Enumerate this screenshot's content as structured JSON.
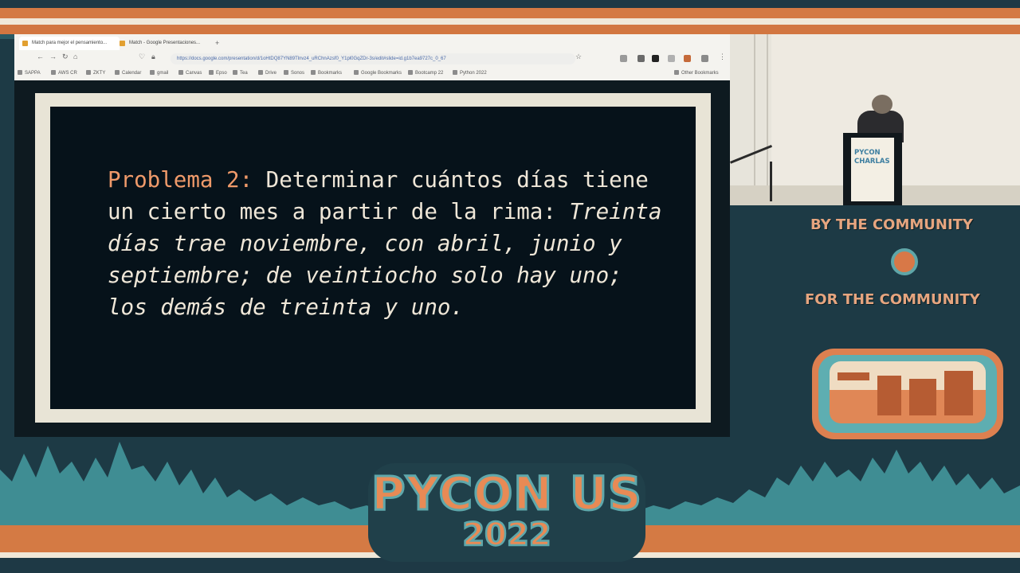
{
  "browser": {
    "tabs": [
      {
        "label": "Match para mejor el pensamiento..."
      },
      {
        "label": "Match - Google Presentaciones..."
      }
    ],
    "new_tab_icon": "plus-icon",
    "url": "https://docs.google.com/presentation/d/1oHtDQ87YN89Tlnvz4_uRChnAzsf0_Y1pl0GqZDr-3s/edit#slide=id.g1b7ea9727c_0_67",
    "bookmarks": [
      "SAPPA",
      "AWS CR",
      "ZKTY",
      "Calendar",
      "gmail",
      "Canvas",
      "Epso",
      "Tea",
      "Drive",
      "Sonos",
      "Bookmarks",
      "Google Bookmarks",
      "Bootcamp 22",
      "Python 2022"
    ],
    "other_bookmarks": "Other Bookmarks"
  },
  "slide": {
    "label": "Problema 2:",
    "statement": " Determinar cuántos días tiene un cierto mes a partir de la rima: ",
    "rhyme": "Treinta días trae noviembre, con abril, junio y septiembre; de veintiocho solo hay uno; los demás de treinta y uno."
  },
  "video": {
    "podium_label": "PYCON CHARLAS"
  },
  "branding": {
    "tagline_top": "BY THE COMMUNITY",
    "tagline_bottom": "FOR THE COMMUNITY",
    "event_name": "PYCON US",
    "event_year": "2022",
    "accent_orange": "#d47a44",
    "accent_teal": "#5fa8ab",
    "background": "#1d3a45"
  }
}
